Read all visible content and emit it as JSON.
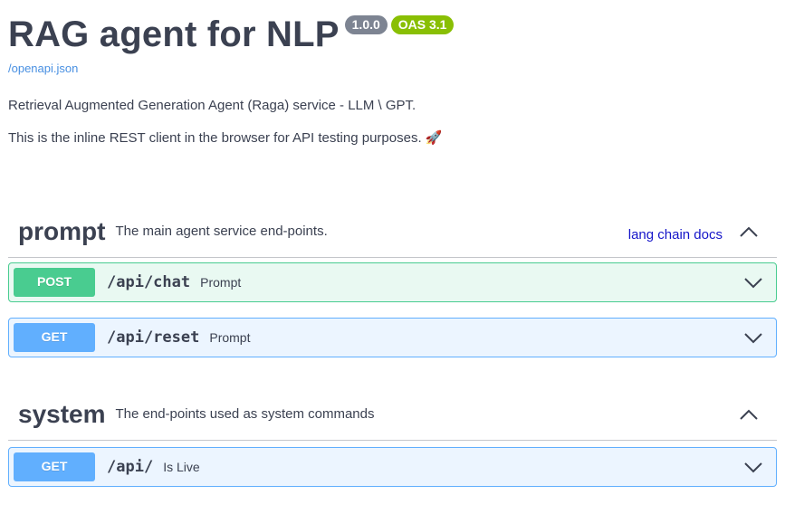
{
  "info": {
    "title": "RAG agent for NLP",
    "version_badge": "1.0.0",
    "oas_badge": "OAS 3.1",
    "spec_link": "/openapi.json",
    "description_line1": "Retrieval Augmented Generation Agent (Raga) service - LLM \\ GPT.",
    "description_line2": "This is the inline REST client in the browser for API testing purposes. 🚀"
  },
  "tags": [
    {
      "name": "prompt",
      "description": "The main agent service end-points.",
      "external_link": "lang chain docs",
      "operations": [
        {
          "method": "POST",
          "path": "/api/chat",
          "summary": "Prompt"
        },
        {
          "method": "GET",
          "path": "/api/reset",
          "summary": "Prompt"
        }
      ]
    },
    {
      "name": "system",
      "description": "The end-points used as system commands",
      "operations": [
        {
          "method": "GET",
          "path": "/api/",
          "summary": "Is Live"
        }
      ]
    }
  ],
  "colors": {
    "post": "#49cc90",
    "get": "#61affe",
    "version_badge": "#7d8492",
    "oas_badge": "#89bf04",
    "link": "#4990e2"
  },
  "icons": {
    "tag_toggle": "chevron-up-icon",
    "op_toggle": "chevron-down-icon"
  }
}
